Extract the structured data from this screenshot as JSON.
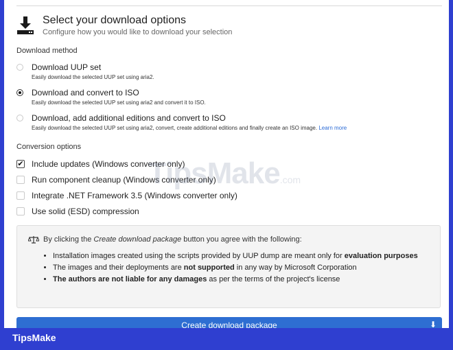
{
  "header": {
    "title": "Select your download options",
    "subtitle": "Configure how you would like to download your selection"
  },
  "download_method": {
    "label": "Download method",
    "options": [
      {
        "label": "Download UUP set",
        "desc": "Easily download the selected UUP set using aria2.",
        "checked": false
      },
      {
        "label": "Download and convert to ISO",
        "desc": "Easily download the selected UUP set using aria2 and convert it to ISO.",
        "checked": true
      },
      {
        "label": "Download, add additional editions and convert to ISO",
        "desc": "Easily download the selected UUP set using aria2, convert, create additional editions and finally create an ISO image.",
        "link": "Learn more",
        "checked": false
      }
    ]
  },
  "conversion_options": {
    "label": "Conversion options",
    "options": [
      {
        "label": "Include updates (Windows converter only)",
        "checked": true
      },
      {
        "label": "Run component cleanup (Windows converter only)",
        "checked": false
      },
      {
        "label": "Integrate .NET Framework 3.5 (Windows converter only)",
        "checked": false
      },
      {
        "label": "Use solid (ESD) compression",
        "checked": false
      }
    ]
  },
  "notice": {
    "pre": "By clicking the ",
    "em": "Create download package",
    "post": " button you agree with the following:",
    "items": [
      {
        "pre": "Installation images created using the scripts provided by UUP dump are meant only for ",
        "strong": "evaluation purposes",
        "post": ""
      },
      {
        "pre": "The images and their deployments are ",
        "strong": "not supported",
        "post": " in any way by Microsoft Corporation"
      },
      {
        "pre": "",
        "strong": "The authors are not liable for any damages",
        "post": " as per the terms of the project's license"
      }
    ]
  },
  "button": {
    "label": "Create download package"
  },
  "watermark": {
    "main": "TipsMake",
    "suffix": ".com"
  },
  "brand": "TipsMake",
  "colors": {
    "accent": "#2e6ed2",
    "frame": "#2f3fd0",
    "link": "#2b6bd6"
  }
}
